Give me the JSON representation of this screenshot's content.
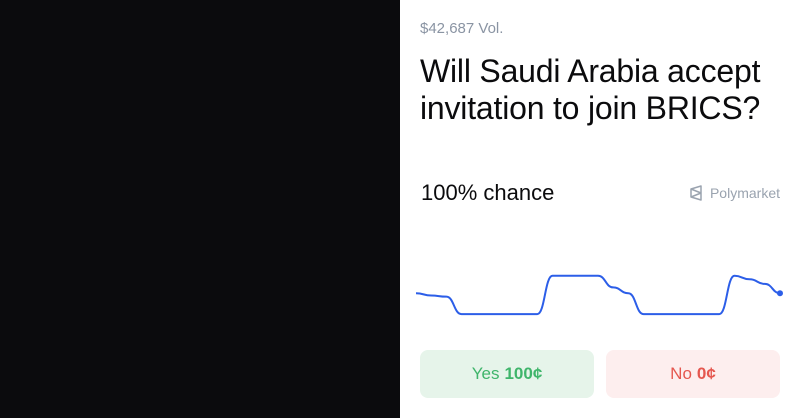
{
  "market": {
    "volume": "$42,687 Vol.",
    "title": "Will Saudi Arabia accept invitation to join BRICS?",
    "chance": "100% chance",
    "brand": "Polymarket"
  },
  "buttons": {
    "yes_label": "Yes",
    "yes_price": "100¢",
    "no_label": "No",
    "no_price": "0¢"
  },
  "colors": {
    "line": "#2c5ee8",
    "yes_text": "#3fb56b",
    "yes_bg": "#e6f4ea",
    "no_text": "#e5574f",
    "no_bg": "#fdeeee"
  },
  "chart_data": {
    "type": "line",
    "series": [
      {
        "values": [
          30,
          28,
          27,
          12,
          12,
          12,
          12,
          12,
          12,
          45,
          45,
          45,
          45,
          35,
          30,
          12,
          12,
          12,
          12,
          12,
          12,
          45,
          42,
          38,
          30
        ]
      }
    ]
  }
}
